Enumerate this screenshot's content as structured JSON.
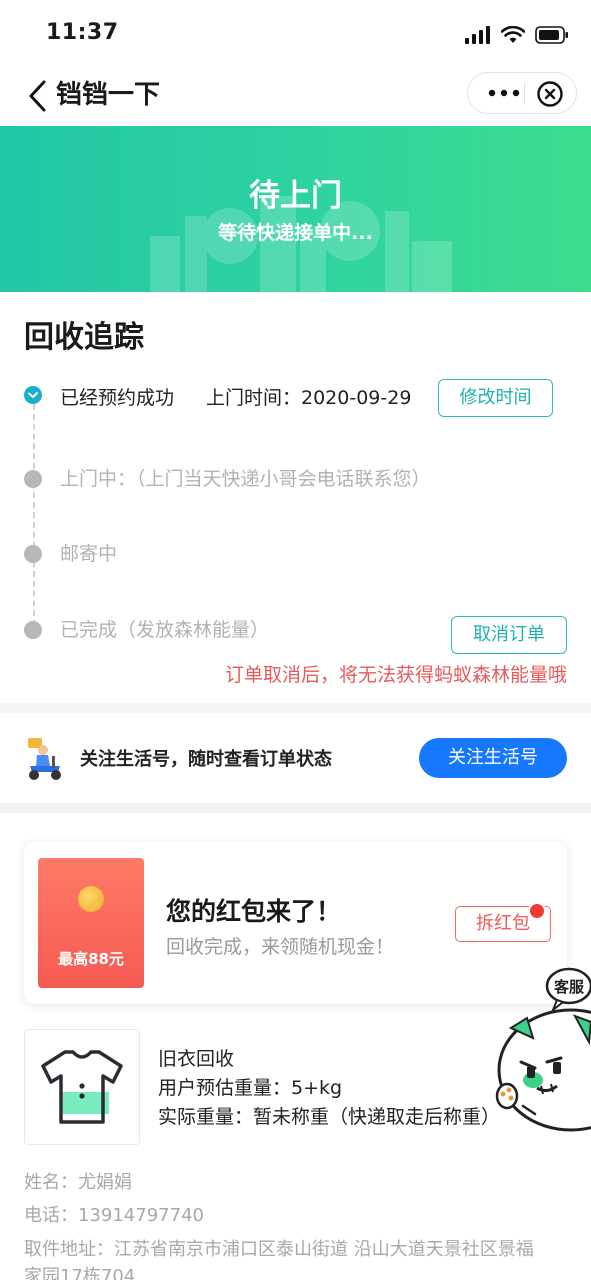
{
  "status_bar": {
    "time": "11:37"
  },
  "nav": {
    "title": "铛铛一下"
  },
  "banner": {
    "title": "待上门",
    "subtitle": "等待快递接单中..."
  },
  "tracking": {
    "title": "回收追踪",
    "steps": [
      {
        "label": "已经预约成功",
        "extra": "上门时间：2020-09-29",
        "state": "done"
      },
      {
        "label": "上门中：（上门当天快递小哥会电话联系您）",
        "state": "pending"
      },
      {
        "label": "邮寄中",
        "state": "pending"
      },
      {
        "label": "已完成（发放森林能量）",
        "state": "pending"
      }
    ],
    "modify_time_button": "修改时间",
    "cancel_order_button": "取消订单",
    "warning": "订单取消后，将无法获得蚂蚁森林能量哦"
  },
  "follow": {
    "text": "关注生活号，随时查看订单状态",
    "button": "关注生活号"
  },
  "red_packet": {
    "amount_label": "最高88元",
    "title": "您的红包来了！",
    "subtitle": "回收完成，来领随机现金！",
    "button": "拆红包"
  },
  "service": {
    "label": "客服"
  },
  "item": {
    "name": "旧衣回收",
    "estimated_weight": "用户预估重量：5+kg",
    "actual_weight": "实际重量：暂未称重（快递取走后称重）"
  },
  "contact": {
    "name": "姓名：尤娟娟",
    "phone": "电话：13914797740",
    "address_line1": "取件地址：江苏省南京市浦口区泰山街道 沿山大道天景社区景福",
    "address_line2": "家园17栋704"
  },
  "colors": {
    "accent_teal": "#2cbcb5",
    "brand_blue": "#1677ff",
    "warning_red": "#e85a5a",
    "banner_start": "#22c7a6",
    "banner_end": "#3fdc8d"
  }
}
